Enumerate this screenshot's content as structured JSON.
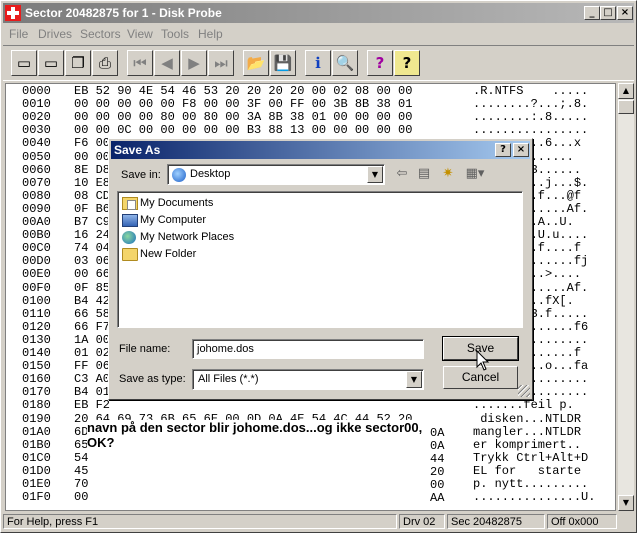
{
  "window": {
    "title": "Sector 20482875 for 1 - Disk Probe"
  },
  "menu": [
    "File",
    "Drives",
    "Sectors",
    "View",
    "Tools",
    "Help"
  ],
  "hex": {
    "rows": [
      {
        "off": "0000",
        "bytes": "EB 52 90 4E 54 46 53 20 20 20 20 00 02 08 00 00",
        "ascii": ".R.NTFS    ....."
      },
      {
        "off": "0010",
        "bytes": "00 00 00 00 00 F8 00 00 3F 00 FF 00 3B 8B 38 01",
        "ascii": "........?...;.8."
      },
      {
        "off": "0020",
        "bytes": "00 00 00 00 80 00 80 00 3A 8B 38 01 00 00 00 00",
        "ascii": "........:.8....."
      },
      {
        "off": "0030",
        "bytes": "00 00 0C 00 00 00 00 00 B3 88 13 00 00 00 00 00",
        "ascii": "................"
      },
      {
        "off": "0040",
        "bytes": "F6 00",
        "ascii": "..........6...x"
      },
      {
        "off": "0050",
        "bytes": "00 00",
        "ascii": ".......|......"
      },
      {
        "off": "0060",
        "bytes": "8E D8",
        "ascii": "........3......"
      },
      {
        "off": "0070",
        "bytes": "10 E8",
        "ascii": "..........j...$."
      },
      {
        "off": "0080",
        "bytes": "08 CD",
        "ascii": ".........f...@f"
      },
      {
        "off": "0090",
        "bytes": "0F B6",
        "ascii": ".............Af."
      },
      {
        "off": "00A0",
        "bytes": "B7 C9",
        "ascii": ".........A..U."
      },
      {
        "off": "00B0",
        "bytes": "16 24",
        "ascii": ".........U.u...."
      },
      {
        "off": "00C0",
        "bytes": "74 04",
        "ascii": "`...f....f....f"
      },
      {
        "off": "00D0",
        "bytes": "03 06",
        "ascii": "..............fj"
      },
      {
        "off": "00E0",
        "bytes": "00 66",
        "ascii": "..........>...."
      },
      {
        "off": "00F0",
        "bytes": "0F 85",
        "ascii": ">............Af."
      },
      {
        "off": "0100",
        "bytes": "B4 42",
        "ascii": "..........fX[."
      },
      {
        "off": "0110",
        "bytes": "66 58",
        "ascii": "........3.f....."
      },
      {
        "off": "0120",
        "bytes": "66 F7",
        "ascii": "..............f6"
      },
      {
        "off": "0130",
        "bytes": "1A 00",
        "ascii": "................"
      },
      {
        "off": "0140",
        "bytes": "01 02",
        "ascii": "..............f"
      },
      {
        "off": "0150",
        "bytes": "FF 06",
        "ascii": "....f.....o...fa"
      },
      {
        "off": "0160",
        "bytes": "C3 A0",
        "ascii": "................"
      },
      {
        "off": "0170",
        "bytes": "B4 01",
        "ascii": "................"
      },
      {
        "off": "0180",
        "bytes": "EB F2",
        "ascii": ".......feil p."
      },
      {
        "off": "0190",
        "bytes": "20 64 69 73 6B 65 6E 00 0D 0A 4E 54 4C 44 52 20",
        "ascii": " disken...NTLDR "
      },
      {
        "off": "01A0",
        "bytes": "6D",
        "ascii": "mangler...NTLDR"
      },
      {
        "off": "01B0",
        "bytes": "65",
        "ascii": "er komprimert.."
      },
      {
        "off": "01C0",
        "bytes": "54",
        "ascii": "Trykk Ctrl+Alt+D"
      },
      {
        "off": "01D0",
        "bytes": "45",
        "ascii": "EL for   starte"
      },
      {
        "off": "01E0",
        "bytes": "70",
        "ascii": "p. nytt........."
      },
      {
        "off": "01F0",
        "bytes": "00",
        "ascii": "...............U."
      }
    ],
    "right_bytes": [
      {
        "row": 26,
        "val": "0A"
      },
      {
        "row": 27,
        "val": "0A"
      },
      {
        "row": 28,
        "val": "44"
      },
      {
        "row": 29,
        "val": "20"
      },
      {
        "row": 30,
        "val": "00"
      },
      {
        "row": 31,
        "val": "AA"
      }
    ]
  },
  "annotation": "navn på den sector blir johome.dos...og ikke sector00,\nOK?",
  "status": {
    "help": "For Help, press F1",
    "drive": "Drv  02",
    "sector": "Sec 20482875",
    "offset": "Off 0x000"
  },
  "dialog": {
    "title": "Save As",
    "save_in_label": "Save in:",
    "save_in_value": "Desktop",
    "items": [
      "My Documents",
      "My Computer",
      "My Network Places",
      "New Folder"
    ],
    "filename_label": "File name:",
    "filename_value": "johome.dos",
    "type_label": "Save as type:",
    "type_value": "All Files (*.*)",
    "save_button": "Save",
    "cancel_button": "Cancel"
  }
}
